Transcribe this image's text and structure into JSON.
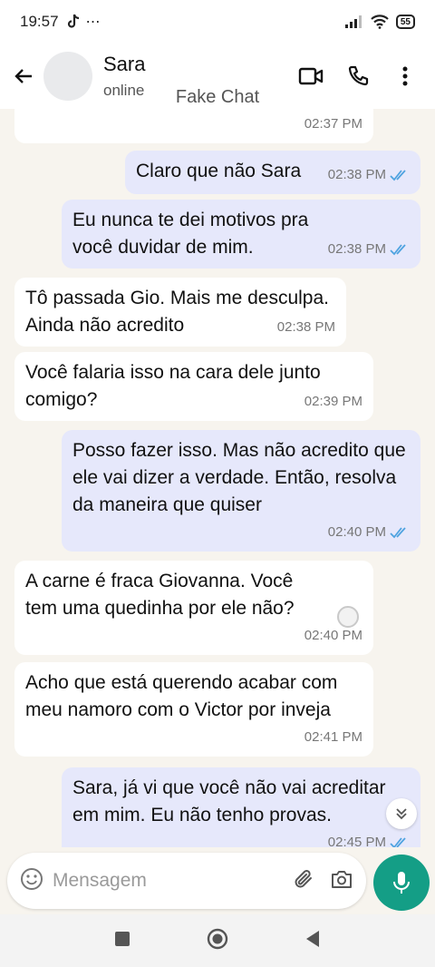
{
  "status_bar": {
    "time": "19:57",
    "battery": "55"
  },
  "header": {
    "contact_name": "Sara",
    "contact_status": "online"
  },
  "watermark": "Fake Chat",
  "messages": [
    {
      "dir": "in",
      "text": "",
      "time": "02:37 PM"
    },
    {
      "dir": "out",
      "text": "Claro que não Sara",
      "time": "02:38 PM",
      "read": true
    },
    {
      "dir": "out",
      "text": "Eu nunca te dei motivos pra você duvidar de mim.",
      "time": "02:38 PM",
      "read": true
    },
    {
      "dir": "in",
      "text": "Tô passada Gio. Mais me desculpa. Ainda não acredito",
      "time": "02:38 PM"
    },
    {
      "dir": "in",
      "text": "Você falaria isso na cara dele junto comigo?",
      "time": "02:39 PM"
    },
    {
      "dir": "out",
      "text": "Posso fazer isso. Mas não acredito que ele vai dizer a verdade. Então, resolva da maneira que quiser",
      "time": "02:40 PM",
      "read": true
    },
    {
      "dir": "in",
      "text": "A carne é fraca Giovanna. Você tem uma quedinha por ele não?",
      "time": "02:40 PM"
    },
    {
      "dir": "in",
      "text": "Acho que está querendo acabar com meu namoro com o Victor por inveja",
      "time": "02:41 PM"
    },
    {
      "dir": "out",
      "text": "Sara, já vi que você não vai acreditar em mim. Eu não tenho provas.",
      "time": "02:45 PM",
      "read": true
    }
  ],
  "composer": {
    "placeholder": "Mensagem"
  },
  "colors": {
    "accent": "#149e86",
    "outgoing_bubble": "#e6e8fb",
    "incoming_bubble": "#ffffff",
    "read_ticks": "#4fa3e0"
  }
}
